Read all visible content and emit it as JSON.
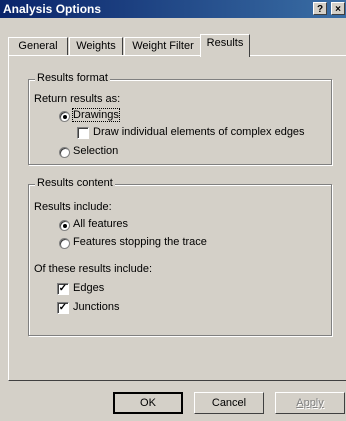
{
  "window": {
    "title": "Analysis Options",
    "help_label": "?",
    "close_label": "×"
  },
  "tabs": [
    "General",
    "Weights",
    "Weight Filter",
    "Results"
  ],
  "results_format": {
    "legend": "Results format",
    "return_label": "Return results as:",
    "drawings_label": "Drawings",
    "draw_elements_label": "Draw individual elements of complex edges",
    "selection_label": "Selection",
    "selected": "Drawings",
    "draw_elements_checked": false
  },
  "results_content": {
    "legend": "Results content",
    "include_label": "Results include:",
    "all_features_label": "All features",
    "stopping_label": "Features stopping the trace",
    "selected": "All features",
    "of_these_label": "Of these results include:",
    "edges_label": "Edges",
    "junctions_label": "Junctions",
    "edges_checked": true,
    "junctions_checked": true
  },
  "buttons": {
    "ok": "OK",
    "cancel": "Cancel",
    "apply": "Apply"
  }
}
